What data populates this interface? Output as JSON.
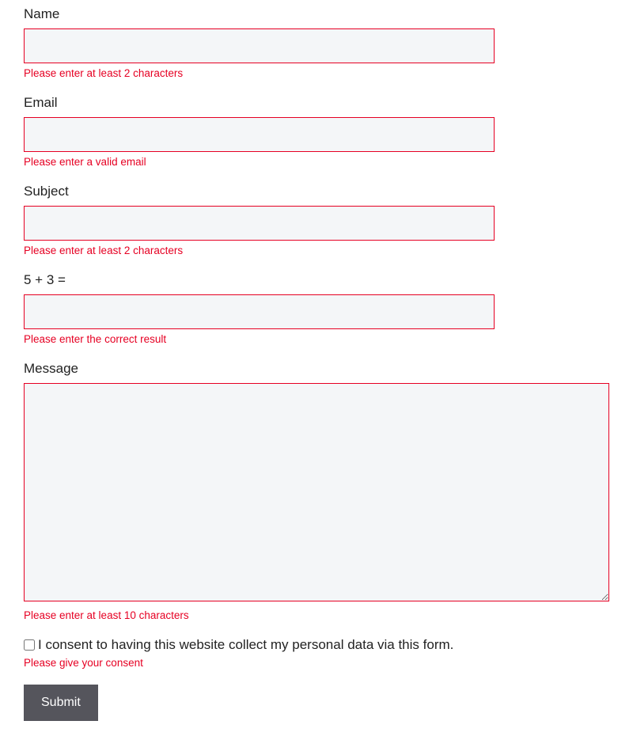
{
  "fields": {
    "name": {
      "label": "Name",
      "value": "",
      "error": "Please enter at least 2 characters"
    },
    "email": {
      "label": "Email",
      "value": "",
      "error": "Please enter a valid email"
    },
    "subject": {
      "label": "Subject",
      "value": "",
      "error": "Please enter at least 2 characters"
    },
    "captcha": {
      "label": "5 + 3 =",
      "value": "",
      "error": "Please enter the correct result"
    },
    "message": {
      "label": "Message",
      "value": "",
      "error": "Please enter at least 10 characters"
    },
    "consent": {
      "label": "I consent to having this website collect my personal data via this form.",
      "checked": false,
      "error": "Please give your consent"
    }
  },
  "submit": {
    "label": "Submit"
  }
}
